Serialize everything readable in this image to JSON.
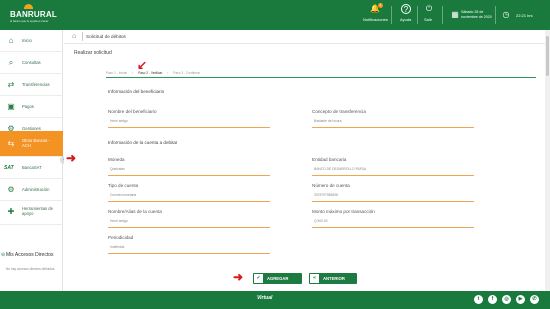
{
  "header": {
    "logo_text": "BANRURAL",
    "logo_tagline": "el banco que te ayuda a crecer",
    "notifications_label": "Notificaciones",
    "notifications_count": "1",
    "help_label": "Ayuda",
    "exit_label": "Salir",
    "date_text": "Sábado 28 de noviembre de 2020",
    "time_text": "22:21 hrs"
  },
  "sidebar": {
    "items": [
      {
        "icon": "home-icon",
        "label": "Inicio"
      },
      {
        "icon": "search-icon",
        "label": "Consultas"
      },
      {
        "icon": "transfer-icon",
        "label": "Transferencias"
      },
      {
        "icon": "payments-icon",
        "label": "Pagos"
      },
      {
        "icon": "management-icon",
        "label": "Gestiones"
      },
      {
        "icon": "other-banks-icon",
        "label": "Otros Bancos - ACH"
      },
      {
        "icon": "banca-logo",
        "label": "BancaSAT"
      },
      {
        "icon": "admin-icon",
        "label": "Administración"
      },
      {
        "icon": "tools-icon",
        "label": "Herramientas de apoyo"
      }
    ],
    "direct_access_title": "Mis Accesos Directos",
    "direct_access_note": "No hay accesos directos definidos."
  },
  "main": {
    "page_title": "Solicitud de débitos",
    "section_title": "Realizar solicitud",
    "steps": [
      "Paso 1 - Iniciar",
      "Paso 2 - Verificar",
      "Paso 3 - Confirmar"
    ],
    "beneficiary_group": "Información del beneficiario",
    "fields": {
      "beneficiary_name_label": "Nombre del beneficiario",
      "beneficiary_name_value": "Henri amigo",
      "concept_label": "Concepto de transferencia",
      "concept_value": "Bastante de locura",
      "account_group": "Información de la cuenta a debitar",
      "currency_label": "Moneda",
      "currency_value": "Quetzales",
      "bank_label": "Entidad bancaria",
      "bank_value": "BANCO DE DESARROLLO RURAL",
      "account_type_label": "Tipo de cuenta",
      "account_type_value": "Cuenta monetaria",
      "account_number_label": "Número de cuenta",
      "account_number_value": "3078797956838",
      "alias_label": "Nombre/Alias de la cuenta",
      "alias_value": "Henri amigo",
      "max_amount_label": "Monto máximo por transacción",
      "max_amount_value": "Q 500.00",
      "periodicity_label": "Periodicidad",
      "periodicity_value": "Indefinida"
    },
    "add_button": "AGREGAR",
    "back_button": "ANTERIOR"
  },
  "footer": {
    "logo_text": "Virtual",
    "social": [
      "twitter-icon",
      "facebook-icon",
      "instagram-icon",
      "youtube-icon",
      "whatsapp-icon",
      "pinterest-icon"
    ]
  },
  "colors": {
    "brand_green": "#1a7a3e",
    "accent_orange": "#f39323",
    "arrow_red": "#d91a1a"
  }
}
